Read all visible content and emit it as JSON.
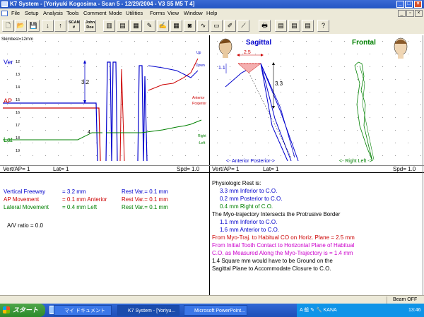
{
  "window": {
    "title": "K7 System - [Yoriyuki Kogosima - Scan 5 - 12/29/2004 - V3 S5      M5   T 4]",
    "controls": [
      "_",
      "□",
      "×"
    ]
  },
  "menu": [
    {
      "label": "File"
    },
    {
      "label": "Setup"
    },
    {
      "label": "Analysis"
    },
    {
      "label": "Tools"
    },
    {
      "label": "Comment"
    },
    {
      "label": "Mode"
    },
    {
      "label": "Utilities"
    },
    {
      "label": "Forms"
    },
    {
      "label": "View"
    },
    {
      "label": "Window"
    },
    {
      "label": "Help"
    }
  ],
  "toolbar": {
    "buttons": [
      {
        "name": "new-icon",
        "glyph": "🗋"
      },
      {
        "name": "open-icon",
        "glyph": "📂"
      },
      {
        "name": "save-icon",
        "glyph": "💾"
      },
      {
        "name": "down-arrow-icon",
        "glyph": "↓"
      },
      {
        "name": "up-arrow-icon",
        "glyph": "↑"
      },
      {
        "name": "scan-icon",
        "glyph": "SCAN #"
      },
      {
        "name": "john-doe-icon",
        "glyph": "John Doe"
      },
      {
        "name": "bars-icon",
        "glyph": "▥"
      },
      {
        "name": "chart-icon",
        "glyph": "▤"
      },
      {
        "name": "grid-icon",
        "glyph": "▦"
      },
      {
        "name": "pencil-icon",
        "glyph": "✎"
      },
      {
        "name": "edit-icon",
        "glyph": "✍"
      },
      {
        "name": "table-icon",
        "glyph": "▦"
      },
      {
        "name": "camera-icon",
        "glyph": "◙"
      },
      {
        "name": "wave-icon",
        "glyph": "∿"
      },
      {
        "name": "window-icon",
        "glyph": "▭"
      },
      {
        "name": "pen-icon",
        "glyph": "✐"
      },
      {
        "name": "draw-icon",
        "glyph": "⟋"
      },
      {
        "name": "print-icon",
        "glyph": "🖶"
      },
      {
        "name": "layout1-icon",
        "glyph": "▤"
      },
      {
        "name": "layout2-icon",
        "glyph": "▤"
      },
      {
        "name": "layout3-icon",
        "glyph": "▤"
      },
      {
        "name": "help-icon",
        "glyph": "?"
      }
    ]
  },
  "left_panel": {
    "sweep_label": "Skimbest=12mm",
    "axis_labels": {
      "ver": "Ver",
      "ap": "AP",
      "lat": "Lat"
    },
    "ticks": [
      "12",
      "13",
      "14",
      "15",
      "16",
      "17",
      "18",
      "19"
    ],
    "annotation_32": "3.2",
    "annotation_4": "4",
    "trace_labels": {
      "up": "Up",
      "down": "Down",
      "anterior": "Anterior",
      "posterior": "Posterior",
      "right": "Right",
      "left": "Left"
    },
    "footer": {
      "vert_ap": "Vert/AP= 1",
      "lat": "Lat= 1",
      "spd": "Spd= 1.0"
    }
  },
  "right_panel": {
    "sagittal_title": "Sagittal",
    "frontal_title": "Frontal",
    "dim_25": "2.5",
    "dim_11": "1.1",
    "dim_33": "3.3",
    "anterior_posterior": "<- Anterior  Posterior->",
    "right_left": "<- Right  Left ->",
    "footer": {
      "vert_ap": "Vert/AP= 1",
      "lat": "Lat= 1",
      "spd": "Spd= 1.0"
    }
  },
  "stats": {
    "rows": [
      {
        "label": "Vertical Freeway",
        "value": "= 3.2 mm",
        "rest": "Rest Var.= 0.1 mm",
        "color": "#0000cc"
      },
      {
        "label": "AP Movement",
        "value": "= 0.1 mm Anterior",
        "rest": "Rest Var.= 0.1 mm",
        "color": "#cc0000"
      },
      {
        "label": "Lateral Movement",
        "value": "= 0.4 mm Left",
        "rest": "Rest Var.= 0.1 mm",
        "color": "#008000"
      }
    ],
    "av_ratio": "A/V ratio = 0.0"
  },
  "analysis": {
    "lines": [
      {
        "text": "Physiologic Rest is:",
        "color": "#000000",
        "indent": 0
      },
      {
        "text": "3.3 mm Inferior to C.O.",
        "color": "#0000cc",
        "indent": 1
      },
      {
        "text": "0.2 mm Posterior to C.O.",
        "color": "#0000cc",
        "indent": 1
      },
      {
        "text": "0.4 mm Right of C.O.",
        "color": "#008000",
        "indent": 1
      },
      {
        "text": "The Myo-trajectory Intersects the Protrusive Border",
        "color": "#000000",
        "indent": 0
      },
      {
        "text": "1.1 mm Inferior to C.O.",
        "color": "#0000cc",
        "indent": 1
      },
      {
        "text": "1.6 mm Anterior to C.O.",
        "color": "#0000cc",
        "indent": 1
      },
      {
        "text": "From Myo-Traj. to Habitual CO on Horiz. Plane =  2.5 mm",
        "color": "#cc0000",
        "indent": 0
      },
      {
        "text": "From Initial Tooth Contact to Horizontal Plane of Habitual",
        "color": "#cc00cc",
        "indent": 0
      },
      {
        "text": "C.O. as Measured Along the Myo-Trajectory is = 1.4 mm",
        "color": "#cc00cc",
        "indent": 0
      },
      {
        "text": "1.4  Square mm would have to be Ground on the",
        "color": "#000000",
        "indent": 0
      },
      {
        "text": "Sagittal Plane to  Accommodate Closure to C.O.",
        "color": "#000000",
        "indent": 0
      }
    ]
  },
  "statusbar": {
    "right": "Beam OFF"
  },
  "taskbar": {
    "start": "スタート",
    "items": [
      {
        "label": "マイ ドキュメント",
        "active": false
      },
      {
        "label": "K7 System - [Yoriyu...",
        "active": true
      },
      {
        "label": "Microsoft PowerPoint...",
        "active": false
      }
    ],
    "clock": "13:46",
    "ime": "A 般 ✎ 🔧 KANA"
  },
  "colors": {
    "blue": "#0000cc",
    "red": "#cc0000",
    "green": "#008000",
    "purple": "#cc00cc"
  }
}
